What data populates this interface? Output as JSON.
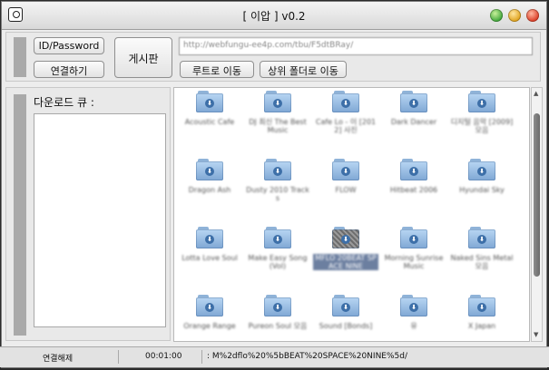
{
  "window": {
    "title": "[ 이압 ] v0.2"
  },
  "login": {
    "id_password_label": "ID/Password",
    "connect_label": "연결하기"
  },
  "board_button_label": "게시판",
  "address": {
    "url_value": "http://webfungu-ee4p.com/tbu/F5dtBRay/"
  },
  "nav": {
    "root_label": "루트로 이동",
    "parent_label": "상위 폴더로 이동"
  },
  "queue": {
    "label": "다운로드 큐 :"
  },
  "files": [
    {
      "name": "Acoustic Cafe"
    },
    {
      "name": "DJ 최신 The Best Music"
    },
    {
      "name": "Cafe Lo - 이 [2012] 사진"
    },
    {
      "name": "Dark Dancer"
    },
    {
      "name": "디지털 음악 [2009] 모음"
    },
    {
      "name": "Dragon Ash"
    },
    {
      "name": "Dusty 2010 Tracks"
    },
    {
      "name": "FLOW"
    },
    {
      "name": "Hitbeat 2006"
    },
    {
      "name": "Hyundai Sky"
    },
    {
      "name": "Lotta Love Soul"
    },
    {
      "name": "Make Easy Song (Vol)"
    },
    {
      "name": "MFLO 20BEAT SPACE NINE",
      "selected": true
    },
    {
      "name": "Morning Sunrise Music"
    },
    {
      "name": "Naked Sins Metal 모음"
    },
    {
      "name": "Orange Range"
    },
    {
      "name": "Pureon Soul 모음"
    },
    {
      "name": "Sound [Bonds]"
    },
    {
      "name": "유"
    },
    {
      "name": "X Japan"
    }
  ],
  "status": {
    "disconnect_label": "연결해제",
    "time": "00:01:00",
    "path": ": M%2dflo%20%5bBEAT%20SPACE%20NINE%5d/"
  }
}
